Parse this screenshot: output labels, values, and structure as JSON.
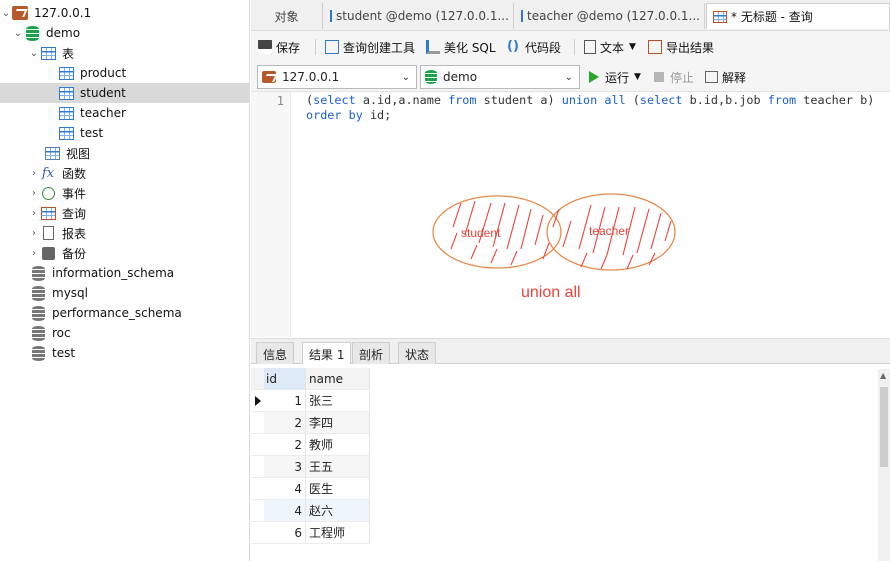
{
  "tree": {
    "connection": "127.0.0.1",
    "database": "demo",
    "tables_folder": "表",
    "tables": [
      "product",
      "student",
      "teacher",
      "test"
    ],
    "selected_table": "student",
    "folders": [
      "视图",
      "函数",
      "事件",
      "查询",
      "报表",
      "备份"
    ],
    "other_databases": [
      "information_schema",
      "mysql",
      "performance_schema",
      "roc",
      "test"
    ]
  },
  "tabs": {
    "objects": "对象",
    "tab1": "student @demo (127.0.0.1...",
    "tab2": "teacher @demo (127.0.0.1...",
    "tab3": "* 无标题 - 查询"
  },
  "toolbar": {
    "save": "保存",
    "builder": "查询创建工具",
    "beautify": "美化 SQL",
    "snippet": "代码段",
    "text": "文本",
    "export": "导出结果"
  },
  "selbar": {
    "connection": "127.0.0.1",
    "database": "demo",
    "run": "运行",
    "stop": "停止",
    "explain": "解释"
  },
  "editor": {
    "line_number": "1",
    "tokens_line1": [
      [
        "(",
        ""
      ],
      [
        "select",
        "kw"
      ],
      [
        " a.id,a.name ",
        ""
      ],
      [
        "from",
        "kw"
      ],
      [
        " student a) ",
        ""
      ],
      [
        "union",
        "kw"
      ],
      [
        " ",
        ""
      ],
      [
        "all",
        "kw"
      ],
      [
        " (",
        ""
      ],
      [
        "select",
        "kw"
      ],
      [
        " b.id,b.job ",
        ""
      ],
      [
        "from",
        "kw"
      ],
      [
        " teacher b)",
        ""
      ]
    ],
    "tokens_line2": [
      [
        "order",
        "kw"
      ],
      [
        " ",
        ""
      ],
      [
        "by",
        "kw"
      ],
      [
        " id;",
        ""
      ]
    ]
  },
  "annotation": {
    "left_label": "student",
    "right_label": "teacher",
    "caption": "union all",
    "color": "#e8433b",
    "ellipse_color": "#e88a4a"
  },
  "result_tabs": [
    "信息",
    "结果 1",
    "剖析",
    "状态"
  ],
  "grid": {
    "columns": [
      "id",
      "name"
    ],
    "rows": [
      [
        "1",
        "张三"
      ],
      [
        "2",
        "李四"
      ],
      [
        "2",
        "教师"
      ],
      [
        "3",
        "王五"
      ],
      [
        "4",
        "医生"
      ],
      [
        "4",
        "赵六"
      ],
      [
        "6",
        "工程师"
      ]
    ]
  }
}
